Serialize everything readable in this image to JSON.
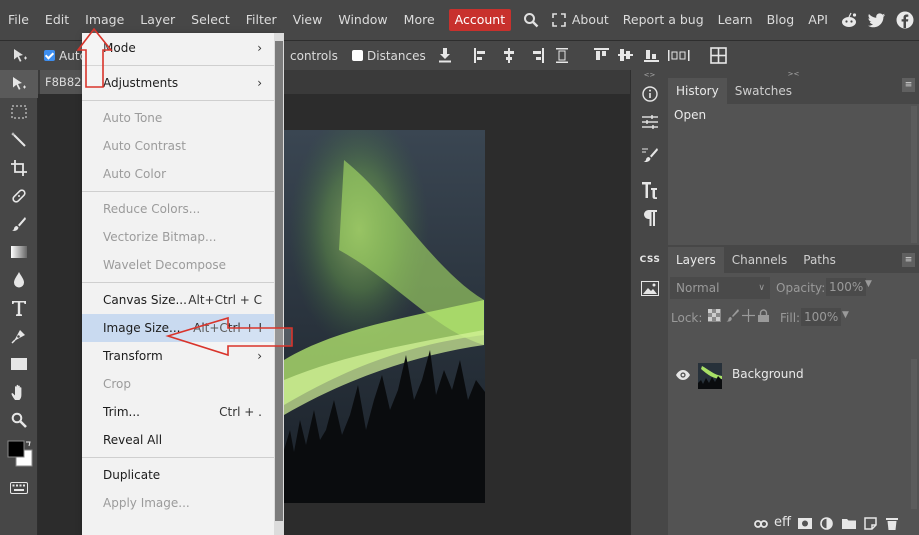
{
  "menubar": {
    "left_items": [
      "File",
      "Edit",
      "Image",
      "Layer",
      "Select",
      "Filter",
      "View",
      "Window",
      "More"
    ],
    "account": "Account",
    "right_items": [
      "About",
      "Report a bug",
      "Learn",
      "Blog",
      "API"
    ]
  },
  "options": {
    "auto_select_label": "Auto",
    "transform_controls_label": "controls",
    "distances_label": "Distances"
  },
  "doc_tab": "F8B82",
  "image_menu": {
    "items": [
      {
        "label": "Mode",
        "submenu": true
      },
      {
        "label": "Adjustments",
        "submenu": true
      },
      {
        "label": "Auto Tone",
        "disabled": true
      },
      {
        "label": "Auto Contrast",
        "disabled": true
      },
      {
        "label": "Auto Color",
        "disabled": true
      },
      {
        "label": "Reduce Colors...",
        "disabled": true
      },
      {
        "label": "Vectorize Bitmap...",
        "disabled": true
      },
      {
        "label": "Wavelet Decompose",
        "disabled": true
      },
      {
        "label": "Canvas Size...",
        "shortcut": "Alt+Ctrl + C"
      },
      {
        "label": "Image Size...",
        "shortcut": "Alt+Ctrl + I"
      },
      {
        "label": "Transform",
        "submenu": true
      },
      {
        "label": "Crop",
        "disabled": true
      },
      {
        "label": "Trim...",
        "shortcut": "Ctrl + ."
      },
      {
        "label": "Reveal All"
      },
      {
        "label": "Duplicate"
      },
      {
        "label": "Apply Image...",
        "disabled": true
      }
    ]
  },
  "history_panel": {
    "tabs": [
      "History",
      "Swatches"
    ],
    "entries": [
      "Open"
    ]
  },
  "layers_panel": {
    "tabs": [
      "Layers",
      "Channels",
      "Paths"
    ],
    "blend_mode": "Normal",
    "opacity_label": "Opacity:",
    "opacity_value": "100%",
    "lock_label": "Lock:",
    "fill_label": "Fill:",
    "fill_value": "100%",
    "layers": [
      {
        "name": "Background"
      }
    ],
    "footer_icons": [
      "link-icon",
      "effects-icon",
      "mask-icon",
      "adjustment-icon",
      "folder-icon",
      "new-layer-icon",
      "trash-icon"
    ],
    "footer_eff": "eff"
  },
  "iconcol": {
    "css_label": "CSS"
  },
  "colors": {
    "accent": "#c8312d",
    "highlight": "#c9daf0",
    "annotation": "#d9342b"
  }
}
